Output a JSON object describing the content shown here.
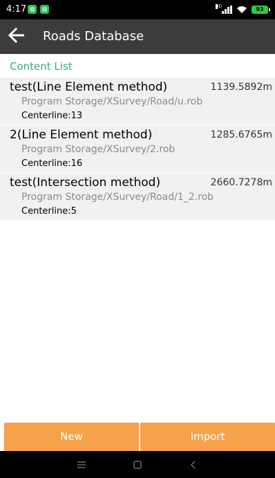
{
  "status_bar": {
    "time": "4:17",
    "signal_label": "HD",
    "battery_level": "93",
    "notification_icons": [
      "app-notification-icon",
      "app-notification-icon"
    ],
    "signal_icon": "cell-signal-icon",
    "wifi_icon": "wifi-icon",
    "battery_icon": "battery-icon"
  },
  "header": {
    "title": "Roads Database",
    "back_icon": "arrow-left-icon"
  },
  "content": {
    "section_label": "Content List",
    "roads": [
      {
        "name": "test(Line Element method)",
        "length": "1139.5892m",
        "path": "Program Storage/XSurvey/Road/u.rob",
        "centerline": "Centerline:13"
      },
      {
        "name": "2(Line Element method)",
        "length": "1285.6765m",
        "path": "Program Storage/XSurvey/2.rob",
        "centerline": "Centerline:16"
      },
      {
        "name": "test(Intersection method)",
        "length": "2660.7278m",
        "path": "Program Storage/XSurvey/Road/1_2.rob",
        "centerline": "Centerline:5"
      }
    ]
  },
  "actions": {
    "new_label": "New",
    "import_label": "Import"
  },
  "nav_bar": {
    "menu_icon": "menu-icon",
    "home_icon": "home-square-icon",
    "back_icon": "back-chevron-icon"
  },
  "colors": {
    "status_bar_bg": "#000000",
    "header_bg": "#3c3c3c",
    "accent_green": "#3daa7a",
    "list_item_bg": "#f1f1f1",
    "action_orange": "#f5a24b",
    "nav_bar_bg": "#000000"
  }
}
